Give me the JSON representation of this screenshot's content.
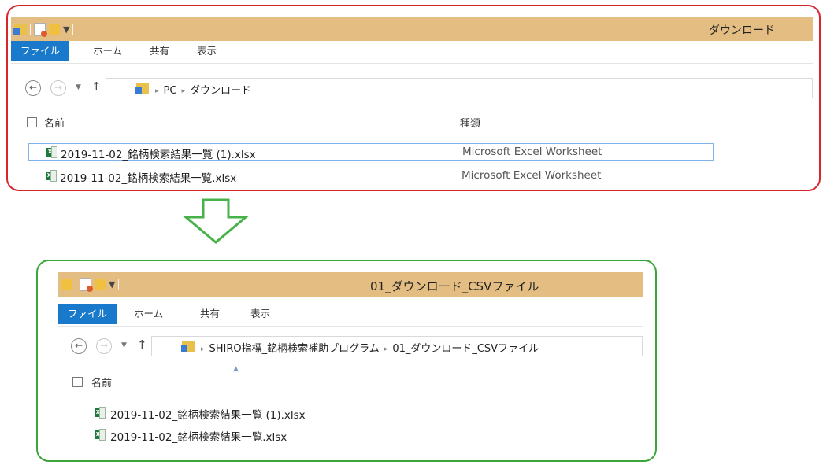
{
  "top": {
    "title": "ダウンロード",
    "tabs": [
      "ファイル",
      "ホーム",
      "共有",
      "表示"
    ],
    "breadcrumb": [
      "PC",
      "ダウンロード"
    ],
    "columns": {
      "name": "名前",
      "type": "種類"
    },
    "files": [
      {
        "name": "2019-11-02_銘柄検索結果一覧 (1).xlsx",
        "type": "Microsoft Excel Worksheet",
        "selected": true
      },
      {
        "name": "2019-11-02_銘柄検索結果一覧.xlsx",
        "type": "Microsoft Excel Worksheet",
        "selected": false
      }
    ]
  },
  "bottom": {
    "title": "01_ダウンロード_CSVファイル",
    "tabs": [
      "ファイル",
      "ホーム",
      "共有",
      "表示"
    ],
    "breadcrumb": [
      "SHIRO指標_銘柄検索補助プログラム",
      "01_ダウンロード_CSVファイル"
    ],
    "columns": {
      "name": "名前"
    },
    "files": [
      {
        "name": "2019-11-02_銘柄検索結果一覧 (1).xlsx"
      },
      {
        "name": "2019-11-02_銘柄検索結果一覧.xlsx"
      }
    ]
  },
  "icons": {
    "back": "←",
    "forward": "→",
    "dropdown": "▼",
    "up": "↑",
    "chevron": "▸",
    "excel_letter": "X"
  },
  "colors": {
    "titlebar": "#e3bd82",
    "file_tab": "#1979ca",
    "top_frame": "#d7262b",
    "bottom_frame": "#3aa63a",
    "arrow": "#47b24a"
  }
}
